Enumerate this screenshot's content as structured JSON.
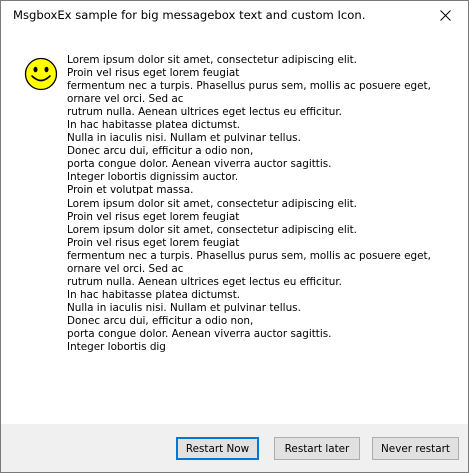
{
  "window": {
    "title": "MsgboxEx sample for big messagebox text and custom Icon."
  },
  "icon": "smiley-face-icon",
  "colors": {
    "smiley_fill": "#ffff00",
    "default_button_border": "#0078d7",
    "footer_bg": "#f0f0f0",
    "button_bg": "#e1e1e1"
  },
  "message": {
    "lines": [
      "Lorem ipsum dolor sit amet, consectetur adipiscing elit.",
      "Proin vel risus eget lorem feugiat",
      "fermentum nec a turpis. Phasellus purus sem, mollis ac posuere eget,",
      "ornare vel orci. Sed ac",
      "rutrum nulla. Aenean ultrices eget lectus eu efficitur.",
      "In hac habitasse platea dictumst.",
      "Nulla in iaculis nisi. Nullam et pulvinar tellus.",
      "Donec arcu dui, efficitur a odio non,",
      "porta congue dolor. Aenean viverra auctor sagittis.",
      "Integer lobortis dignissim auctor.",
      "Proin et volutpat massa.",
      "Lorem ipsum dolor sit amet, consectetur adipiscing elit.",
      "Proin vel risus eget lorem feugiat",
      "Lorem ipsum dolor sit amet, consectetur adipiscing elit.",
      "Proin vel risus eget lorem feugiat",
      "fermentum nec a turpis. Phasellus purus sem, mollis ac posuere eget,",
      "ornare vel orci. Sed ac",
      "rutrum nulla. Aenean ultrices eget lectus eu efficitur.",
      "In hac habitasse platea dictumst.",
      "Nulla in iaculis nisi. Nullam et pulvinar tellus.",
      "Donec arcu dui, efficitur a odio non,",
      "porta congue dolor. Aenean viverra auctor sagittis.",
      "Integer lobortis dig"
    ]
  },
  "buttons": {
    "restart_now": "Restart Now",
    "restart_later": "Restart later",
    "never_restart": "Never restart"
  }
}
